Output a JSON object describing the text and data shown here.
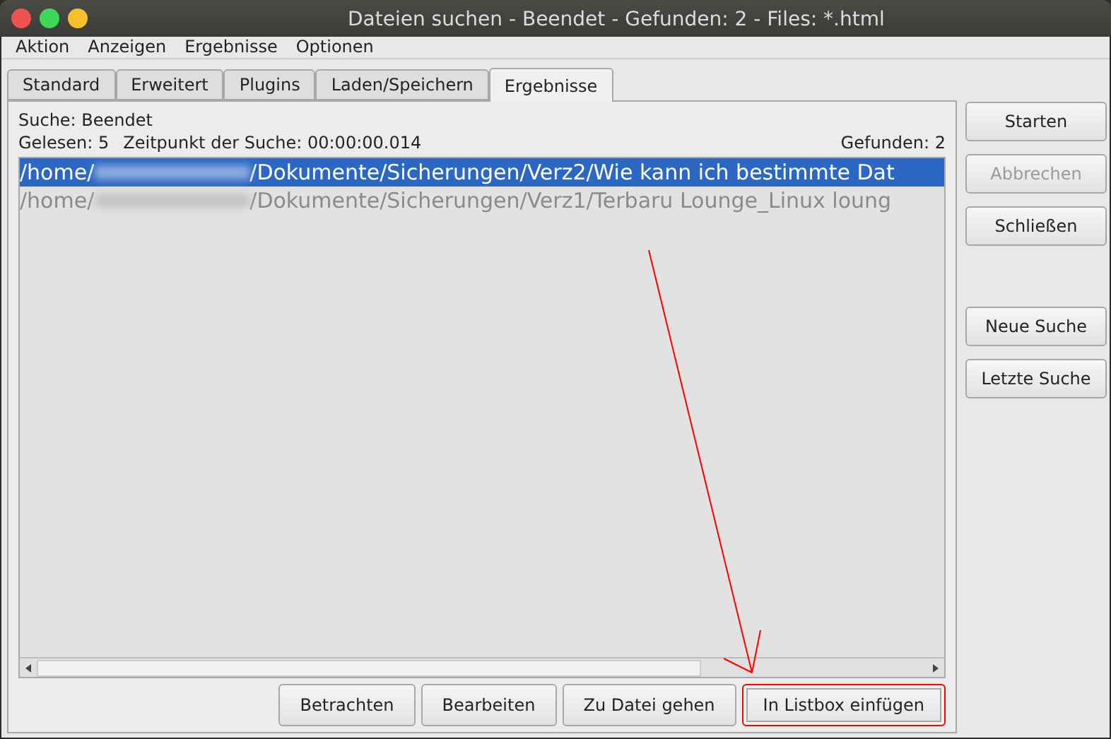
{
  "window": {
    "title": "Dateien suchen - Beendet - Gefunden: 2 - Files: *.html"
  },
  "menu": [
    "Aktion",
    "Anzeigen",
    "Ergebnisse",
    "Optionen"
  ],
  "tabs": [
    {
      "label": "Standard",
      "selected": false
    },
    {
      "label": "Erweitert",
      "selected": false
    },
    {
      "label": "Plugins",
      "selected": false
    },
    {
      "label": "Laden/Speichern",
      "selected": false
    },
    {
      "label": "Ergebnisse",
      "selected": true
    }
  ],
  "status": {
    "search": "Suche: Beendet",
    "read": "Gelesen: 5",
    "time": "Zeitpunkt der Suche: 00:00:00.014",
    "found": "Gefunden: 2"
  },
  "results": [
    {
      "prefix": "/home/",
      "path": "/Dokumente/Sicherungen/Verz2/Wie kann ich bestimmte Dat",
      "selected": true
    },
    {
      "prefix": "/home/",
      "path": "/Dokumente/Sicherungen/Verz1/Terbaru Lounge_Linux loung",
      "selected": false
    }
  ],
  "side_buttons": [
    {
      "label": "Starten",
      "disabled": false
    },
    {
      "label": "Abbrechen",
      "disabled": true
    },
    {
      "label": "Schließen",
      "disabled": false
    },
    {
      "label": "Neue Suche",
      "disabled": false
    },
    {
      "label": "Letzte Suche",
      "disabled": false
    }
  ],
  "bottom_buttons": [
    {
      "label": "Betrachten",
      "highlighted": false
    },
    {
      "label": "Bearbeiten",
      "highlighted": false
    },
    {
      "label": "Zu Datei gehen",
      "highlighted": false
    },
    {
      "label": "In Listbox einfügen",
      "highlighted": true
    }
  ]
}
